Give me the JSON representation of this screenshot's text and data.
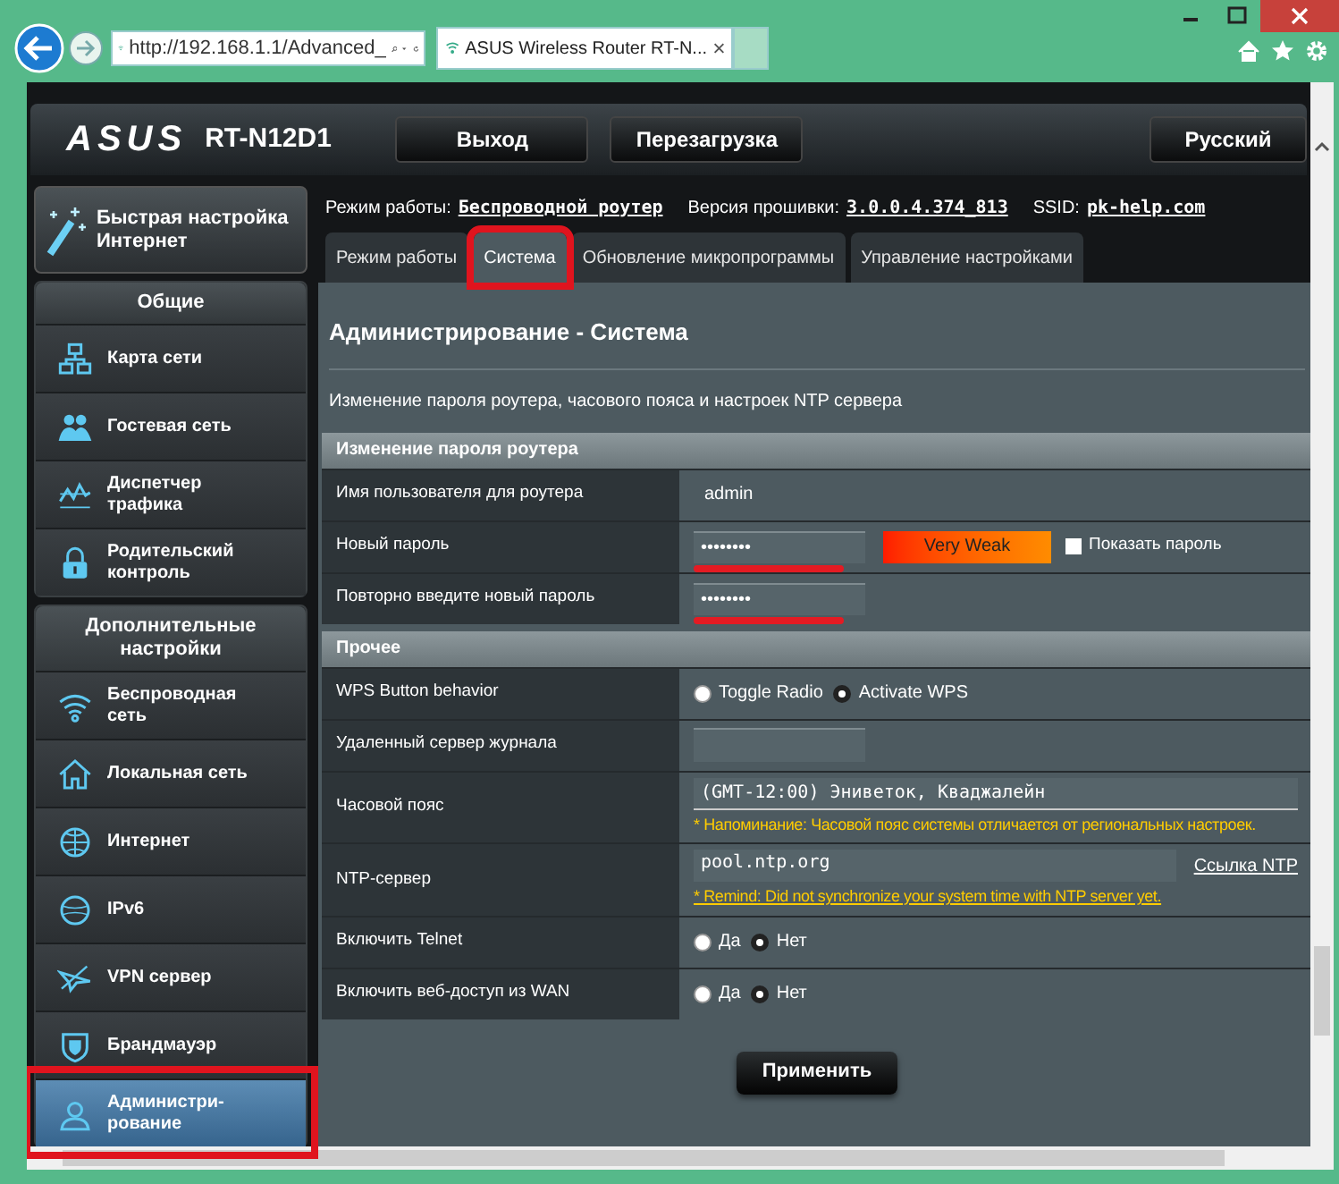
{
  "browser": {
    "address": "http://192.168.1.1/Advanced_",
    "tab_title": "ASUS Wireless Router RT-N..."
  },
  "header": {
    "logo": "ASUS",
    "model": "RT-N12D1",
    "buttons": [
      "Выход",
      "Перезагрузка"
    ],
    "language": "Русский"
  },
  "status": [
    {
      "label": "Режим работы:",
      "value": "Беспроводной роутер"
    },
    {
      "label": "Версия прошивки:",
      "value": "3.0.0.4.374_813"
    },
    {
      "label": "SSID:",
      "value": "pk-help.com"
    }
  ],
  "quick_setup": "Быстрая настройка Интернет",
  "sidebar": {
    "sections": [
      {
        "title": "Общие",
        "items": [
          {
            "label": "Карта сети",
            "selected": false,
            "highlighted": false
          },
          {
            "label": "Гостевая сеть",
            "selected": false,
            "highlighted": false
          },
          {
            "label": "Диспетчер трафика",
            "selected": false,
            "highlighted": false
          },
          {
            "label": "Родительский контроль",
            "selected": false,
            "highlighted": false
          }
        ]
      },
      {
        "title": "Дополнительные настройки",
        "items": [
          {
            "label": "Беспроводная сеть",
            "selected": false,
            "highlighted": false
          },
          {
            "label": "Локальная сеть",
            "selected": false,
            "highlighted": false
          },
          {
            "label": "Интернет",
            "selected": false,
            "highlighted": false
          },
          {
            "label": "IPv6",
            "selected": false,
            "highlighted": false
          },
          {
            "label": "VPN сервер",
            "selected": false,
            "highlighted": false
          },
          {
            "label": "Брандмауэр",
            "selected": false,
            "highlighted": false
          },
          {
            "label": "Администри-рование",
            "selected": true,
            "highlighted": true
          }
        ]
      }
    ]
  },
  "tabs": [
    {
      "label": "Режим работы",
      "selected": false,
      "highlighted": false
    },
    {
      "label": "Система",
      "selected": true,
      "highlighted": true
    },
    {
      "label": "Обновление микропрограммы",
      "selected": false,
      "highlighted": false
    },
    {
      "label": "Управление настройками",
      "selected": false,
      "highlighted": false
    }
  ],
  "page_title": "Администрирование - Система",
  "description": "Изменение пароля роутера, часового пояса и настроек NTP сервера",
  "sections": [
    {
      "title": "Изменение пароля роутера",
      "rows": [
        {
          "kind": "text",
          "label": "Имя пользователя для роутера",
          "value": "admin"
        },
        {
          "kind": "password",
          "label": "Новый пароль",
          "value": "••••••••",
          "underlined": true,
          "strength": "Very Weak",
          "show_label": "Показать пароль",
          "checked": false
        },
        {
          "kind": "password",
          "label": "Повторно введите новый пароль",
          "value": "••••••••",
          "underlined": true
        }
      ]
    },
    {
      "title": "Прочее",
      "rows": [
        {
          "kind": "radio",
          "label": "WPS Button behavior",
          "options": [
            {
              "label": "Toggle Radio",
              "selected": false
            },
            {
              "label": "Activate WPS",
              "selected": true
            }
          ]
        },
        {
          "kind": "input",
          "label": "Удаленный сервер журнала"
        },
        {
          "kind": "select",
          "label": "Часовой пояс",
          "value": "(GMT-12:00) Эниветок, Кваджалейн",
          "note": "* Напоминание: Часовой пояс системы отличается от региональных настроек."
        },
        {
          "kind": "ntp",
          "label": "NTP-сервер",
          "value": "pool.ntp.org",
          "link": "Ссылка NTP",
          "note": "* Remind: Did not synchronize your system time with NTP server yet."
        },
        {
          "kind": "radio",
          "label": "Включить Telnet",
          "options": [
            {
              "label": "Да",
              "selected": false
            },
            {
              "label": "Нет",
              "selected": true
            }
          ]
        },
        {
          "kind": "radio",
          "label": "Включить веб-доступ из WAN",
          "options": [
            {
              "label": "Да",
              "selected": false
            },
            {
              "label": "Нет",
              "selected": true
            }
          ]
        }
      ]
    }
  ],
  "apply_button": "Применить"
}
